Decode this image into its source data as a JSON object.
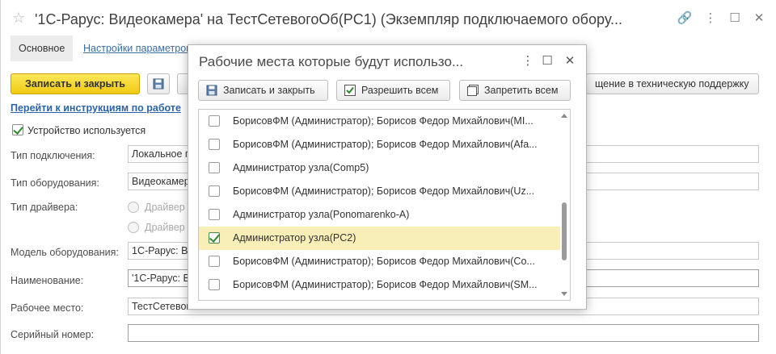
{
  "window": {
    "title": "'1С-Рарус: Видеокамера' на ТестСетевогоОб(PC1) (Экземпляр подключаемого обору...",
    "star_icon": "star-icon"
  },
  "tabs": {
    "main": "Основное",
    "settings": "Настройки параметров"
  },
  "toolbar": {
    "save_close": "Записать и закрыть",
    "support": "щение в техническую поддержку"
  },
  "instructions_link": "Перейти к инструкциям по работе",
  "device_used": {
    "label": "Устройство используется",
    "checked": true
  },
  "form": {
    "connection_type_label": "Тип подключения:",
    "connection_type_value": "Локальное п",
    "equipment_type_label": "Тип оборудования:",
    "equipment_type_value": "Видеокамер",
    "driver_type_label": "Тип драйвера:",
    "driver_option_1": "Драйвер",
    "driver_option_2": "Драйвер",
    "model_label": "Модель оборудования:",
    "model_value": "1С-Рарус: В",
    "name_label": "Наименование:",
    "name_value": "'1С-Рарус: В",
    "workplace_label": "Рабочее место:",
    "workplace_value": "ТестСетевого",
    "serial_label": "Серийный номер:",
    "serial_value": ""
  },
  "dialog": {
    "title": "Рабочие места которые будут использо...",
    "buttons": {
      "save_close": "Записать и закрыть",
      "allow_all": "Разрешить всем",
      "deny_all": "Запретить всем"
    },
    "rows": [
      {
        "text": "БорисовФМ (Администратор); Борисов Федор Михайлович(MI...",
        "checked": false,
        "selected": false
      },
      {
        "text": "БорисовФМ (Администратор); Борисов Федор Михайлович(Afa...",
        "checked": false,
        "selected": false
      },
      {
        "text": "Администратор узла(Comp5)",
        "checked": false,
        "selected": false
      },
      {
        "text": "БорисовФМ (Администратор); Борисов Федор Михайлович(Uz...",
        "checked": false,
        "selected": false
      },
      {
        "text": "Администратор узла(Ponomarenko-A)",
        "checked": false,
        "selected": false
      },
      {
        "text": "Администратор узла(PC2)",
        "checked": true,
        "selected": true
      },
      {
        "text": "БорисовФМ (Администратор); Борисов Федор Михайлович(Co...",
        "checked": false,
        "selected": false
      },
      {
        "text": "БорисовФМ (Администратор); Борисов Федор Михайлович(SM...",
        "checked": false,
        "selected": false
      }
    ]
  },
  "colors": {
    "accent_yellow": "#f0ca13",
    "link_blue": "#2b63a9",
    "selected_row": "#f8eeb8",
    "check_green": "#2e8a2e"
  }
}
